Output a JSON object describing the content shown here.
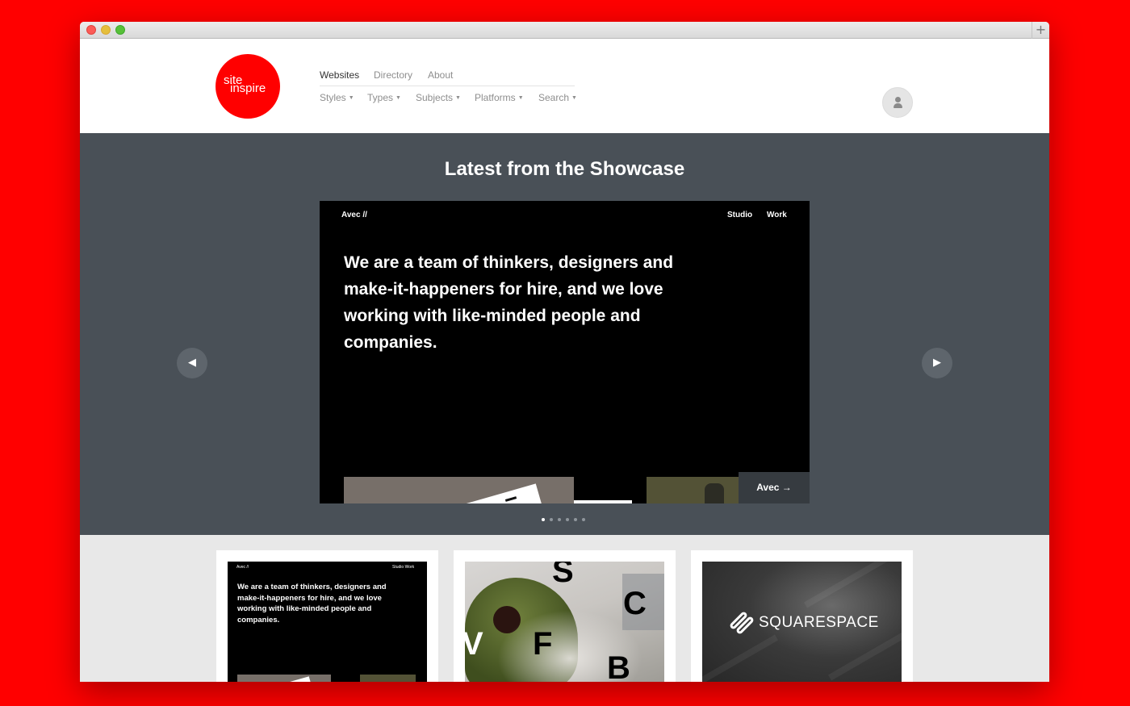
{
  "window": {
    "new_tab_symbol": "+"
  },
  "logo": {
    "line1": "site",
    "line2": "inspire"
  },
  "nav": {
    "primary": [
      "Websites",
      "Directory",
      "About"
    ],
    "secondary": [
      "Styles",
      "Types",
      "Subjects",
      "Platforms",
      "Search"
    ],
    "dropdown_caret": "▼"
  },
  "user_icon": "user-avatar-icon",
  "showcase": {
    "title": "Latest from the Showcase",
    "slide": {
      "site_brand": "Avec //",
      "site_nav": [
        "Studio",
        "Work"
      ],
      "headline": "We are a team of thinkers, designers and make-it-happeners for hire, and we love working with like-minded people and companies.",
      "cta_label": "Avec →"
    },
    "prev_icon": "◀",
    "next_icon": "▶",
    "dot_count": 6,
    "active_dot": 0
  },
  "cards": [
    {
      "brand": "Avec //",
      "nav": "Studio   Work",
      "text": "We are a team of thinkers, designers and make-it-happeners for hire, and we love working with like-minded people and companies."
    },
    {
      "letters": [
        "S",
        "C",
        "F",
        "B",
        "V"
      ]
    },
    {
      "brand_name": "SQUARESPACE"
    }
  ],
  "colors": {
    "brand_red": "#ff0000",
    "showcase_bg": "#495057",
    "grid_bg": "#e8e8e8"
  }
}
